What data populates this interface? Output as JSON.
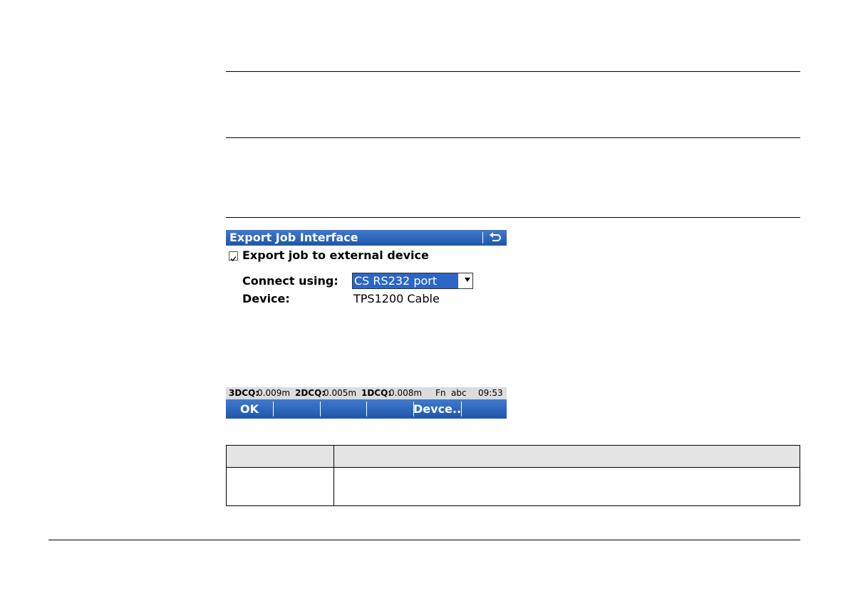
{
  "screen": {
    "title": "Export Job Interface",
    "back_icon": "back-arrow-icon",
    "checkbox_checked": true,
    "checkbox_label": "Export job to external device",
    "connect_label": "Connect using:",
    "connect_value": "CS RS232 port",
    "device_label": "Device:",
    "device_value": "TPS1200 Cable",
    "status": {
      "q3d_label": "3DCQ:",
      "q3d_value": "0.009m",
      "q2d_label": "2DCQ:",
      "q2d_value": "0.005m",
      "q1d_label": "1DCQ:",
      "q1d_value": "0.008m",
      "fn": "Fn",
      "input_mode": "abc",
      "time": "09:53"
    },
    "softkeys": [
      "OK",
      "",
      "",
      "",
      "Devce..",
      ""
    ]
  }
}
